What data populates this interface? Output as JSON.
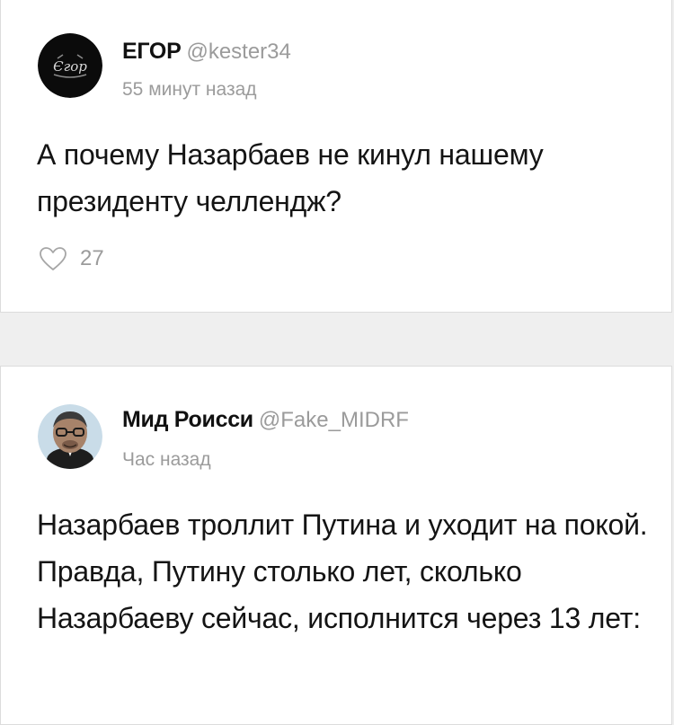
{
  "posts": [
    {
      "author_name": "ЕГОР",
      "author_handle": "@kester34",
      "avatar_label": "Єгор",
      "time": "55 минут назад",
      "text": "А почему Назарбаев не кинул нашему президенту челлендж?",
      "likes": "27",
      "like_icon": "heart-outline-icon"
    },
    {
      "author_name": "Мид Роисси",
      "author_handle": "@Fake_MIDRF",
      "time": "Час назад",
      "text": "Назарбаев троллит Путина и уходит на покой. Правда, Путину столько лет, сколько Назарбаеву сейчас, исполнится через 13 лет:"
    }
  ],
  "colors": {
    "background": "#efefef",
    "card": "#ffffff",
    "muted_text": "#9b9b9b",
    "main_text": "#141414"
  }
}
